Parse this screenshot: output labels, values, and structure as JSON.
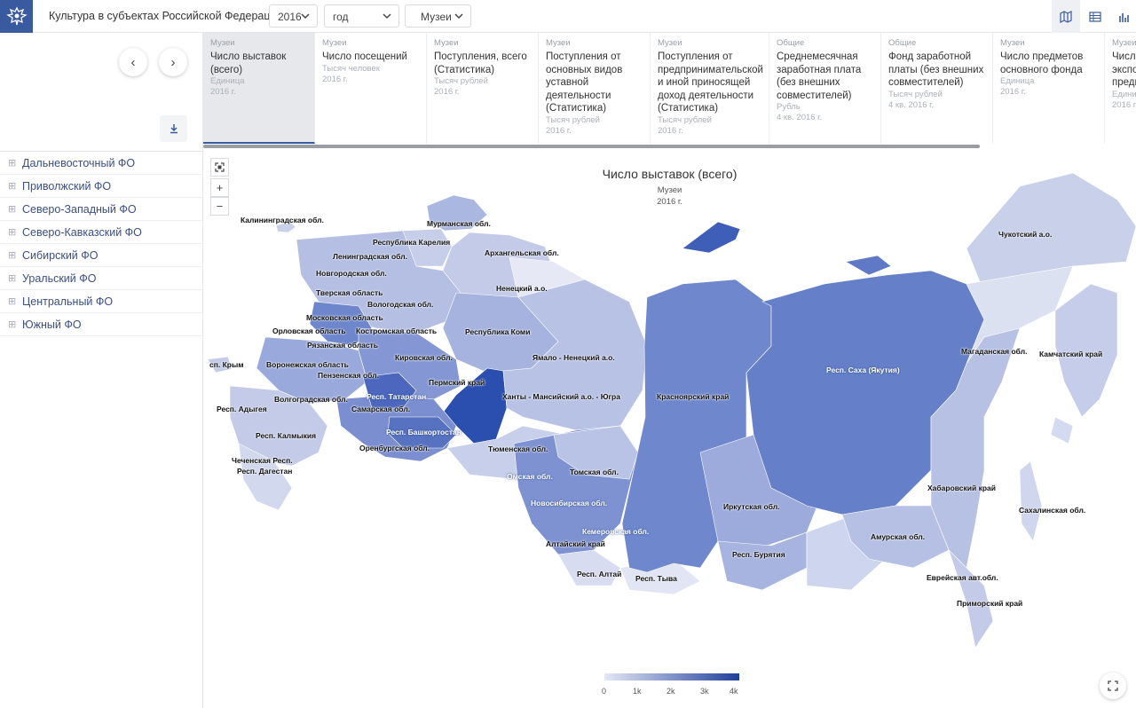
{
  "header": {
    "title": "Культура в субъектах Российской Федерации",
    "year": "2016",
    "period": "год",
    "category": "Музеи"
  },
  "indicators": [
    {
      "category": "Музеи",
      "name": "Число выставок (всего)",
      "unit": "Единица",
      "year": "2016 г."
    },
    {
      "category": "Музеи",
      "name": "Число посещений",
      "unit": "Тысяч человек",
      "year": "2016 г."
    },
    {
      "category": "Музеи",
      "name": "Поступления, всего (Статистика)",
      "unit": "Тысяч рублей",
      "year": "2016 г."
    },
    {
      "category": "Музеи",
      "name": "Поступления от основных видов уставной деятельности (Статистика)",
      "unit": "Тысяч рублей",
      "year": "2016 г."
    },
    {
      "category": "Музеи",
      "name": "Поступления от предпринимательской и иной приносящей доход деятельности (Статистика)",
      "unit": "Тысяч рублей",
      "year": "2016 г."
    },
    {
      "category": "Общие",
      "name": "Среднемесячная заработная плата (без внешних совместителей)",
      "unit": "Рубль",
      "year": "4 кв. 2016 г."
    },
    {
      "category": "Общие",
      "name": "Фонд заработной платы (без внешних совместителей)",
      "unit": "Тысяч рублей",
      "year": "4 кв. 2016 г."
    },
    {
      "category": "Музеи",
      "name": "Число предметов основного фонда",
      "unit": "Единица",
      "year": "2016 г."
    },
    {
      "category": "Музеи",
      "name": "Число экспо предм",
      "unit": "Едини",
      "year": "2016 г."
    }
  ],
  "districts": [
    "Дальневосточный ФО",
    "Приволжский ФО",
    "Северо-Западный ФО",
    "Северо-Кавказский ФО",
    "Сибирский ФО",
    "Уральский ФО",
    "Центральный ФО",
    "Южный ФО"
  ],
  "map": {
    "title": "Число выставок (всего)",
    "subtitle": "Музеи",
    "year": "2016 г.",
    "legend_ticks": [
      "0",
      "1k",
      "2k",
      "3k",
      "4k"
    ],
    "color_low": "#e4e8f6",
    "color_high": "#1f3f9a",
    "regions": [
      {
        "name": "Калининградская обл.",
        "dark": false
      },
      {
        "name": "Мурманская обл.",
        "dark": false
      },
      {
        "name": "Республика Карелия",
        "dark": false
      },
      {
        "name": "Ленинградская обл.",
        "dark": false
      },
      {
        "name": "Архангельская обл.",
        "dark": false
      },
      {
        "name": "Новгородская обл.",
        "dark": false
      },
      {
        "name": "Ненецкий а.о.",
        "dark": false
      },
      {
        "name": "Тверская область",
        "dark": false
      },
      {
        "name": "Вологодская обл.",
        "dark": false
      },
      {
        "name": "Московская область",
        "dark": false
      },
      {
        "name": "Орловская область",
        "dark": false
      },
      {
        "name": "Костромская область",
        "dark": false
      },
      {
        "name": "Республика Коми",
        "dark": false
      },
      {
        "name": "Рязанская область",
        "dark": false
      },
      {
        "name": "сп. Крым",
        "dark": false
      },
      {
        "name": "Воронежская область",
        "dark": false
      },
      {
        "name": "Кировская обл.",
        "dark": false
      },
      {
        "name": "Ямало - Ненецкий а.о.",
        "dark": false
      },
      {
        "name": "Пензенская обл.",
        "dark": false
      },
      {
        "name": "Пермский край",
        "dark": false
      },
      {
        "name": "Респ. Татарстан",
        "dark": true
      },
      {
        "name": "Волгоградская обл.",
        "dark": false
      },
      {
        "name": "Ханты - Мансийский а.о. - Югра",
        "dark": false
      },
      {
        "name": "Респ. Адыгея",
        "dark": false
      },
      {
        "name": "Самарская обл.",
        "dark": false
      },
      {
        "name": "Респ. Башкортостан",
        "dark": true
      },
      {
        "name": "Респ. Калмыкия",
        "dark": false
      },
      {
        "name": "Тюменская обл.",
        "dark": false
      },
      {
        "name": "Оренбургская обл.",
        "dark": false
      },
      {
        "name": "Чеченская Респ.",
        "dark": false
      },
      {
        "name": "Респ. Дагестан",
        "dark": false
      },
      {
        "name": "Омская обл.",
        "dark": true
      },
      {
        "name": "Томская обл.",
        "dark": false
      },
      {
        "name": "Новосибирская обл.",
        "dark": true
      },
      {
        "name": "Кемеровская обл.",
        "dark": true
      },
      {
        "name": "Алтайский край",
        "dark": false
      },
      {
        "name": "Респ. Алтай",
        "dark": false
      },
      {
        "name": "Респ. Тыва",
        "dark": false
      },
      {
        "name": "Красноярский край",
        "dark": false
      },
      {
        "name": "Иркутская обл.",
        "dark": false
      },
      {
        "name": "Респ. Бурятия",
        "dark": false
      },
      {
        "name": "Респ. Саха (Якутия)",
        "dark": true
      },
      {
        "name": "Чукотский а.о.",
        "dark": false
      },
      {
        "name": "Магаданская обл.",
        "dark": false
      },
      {
        "name": "Камчатский край",
        "dark": false
      },
      {
        "name": "Хабаровский край",
        "dark": false
      },
      {
        "name": "Сахалинская обл.",
        "dark": false
      },
      {
        "name": "Амурская обл.",
        "dark": false
      },
      {
        "name": "Еврейская авт.обл.",
        "dark": false
      },
      {
        "name": "Приморский край",
        "dark": false
      }
    ]
  }
}
